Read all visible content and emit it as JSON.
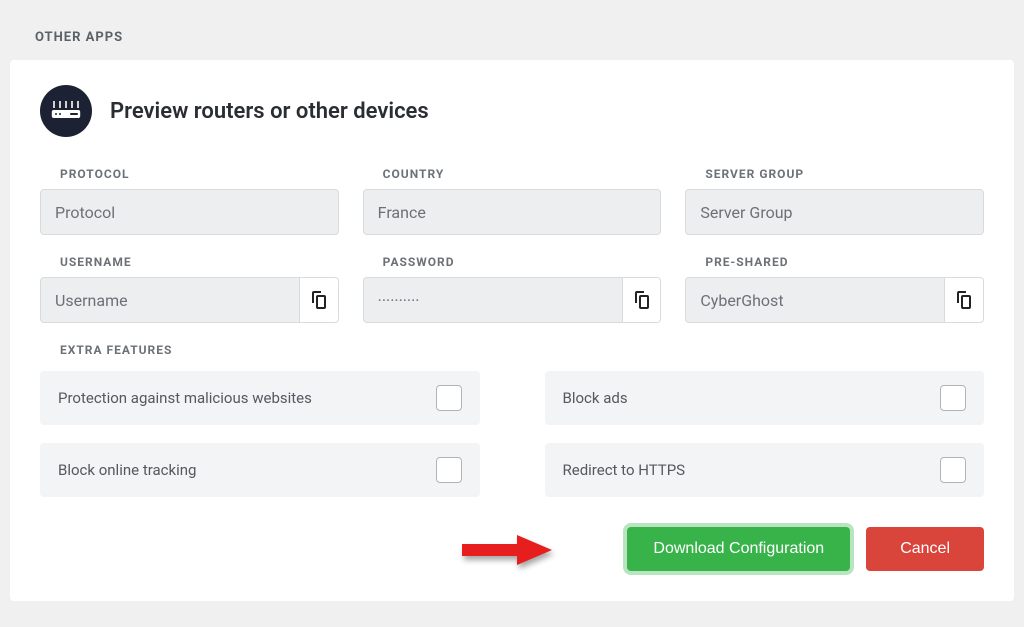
{
  "header": "OTHER APPS",
  "card": {
    "title": "Preview routers or other devices",
    "labels": {
      "protocol": "PROTOCOL",
      "country": "COUNTRY",
      "serverGroup": "SERVER GROUP",
      "username": "USERNAME",
      "password": "PASSWORD",
      "preShared": "PRE-SHARED",
      "extraFeatures": "EXTRA FEATURES"
    },
    "values": {
      "protocol": "Protocol",
      "country": "France",
      "serverGroup": "Server Group",
      "username": "Username",
      "password": "··········",
      "preShared": "CyberGhost"
    },
    "features": {
      "malicious": "Protection against malicious websites",
      "ads": "Block ads",
      "tracking": "Block online tracking",
      "https": "Redirect to HTTPS"
    },
    "buttons": {
      "download": "Download Configuration",
      "cancel": "Cancel"
    }
  }
}
